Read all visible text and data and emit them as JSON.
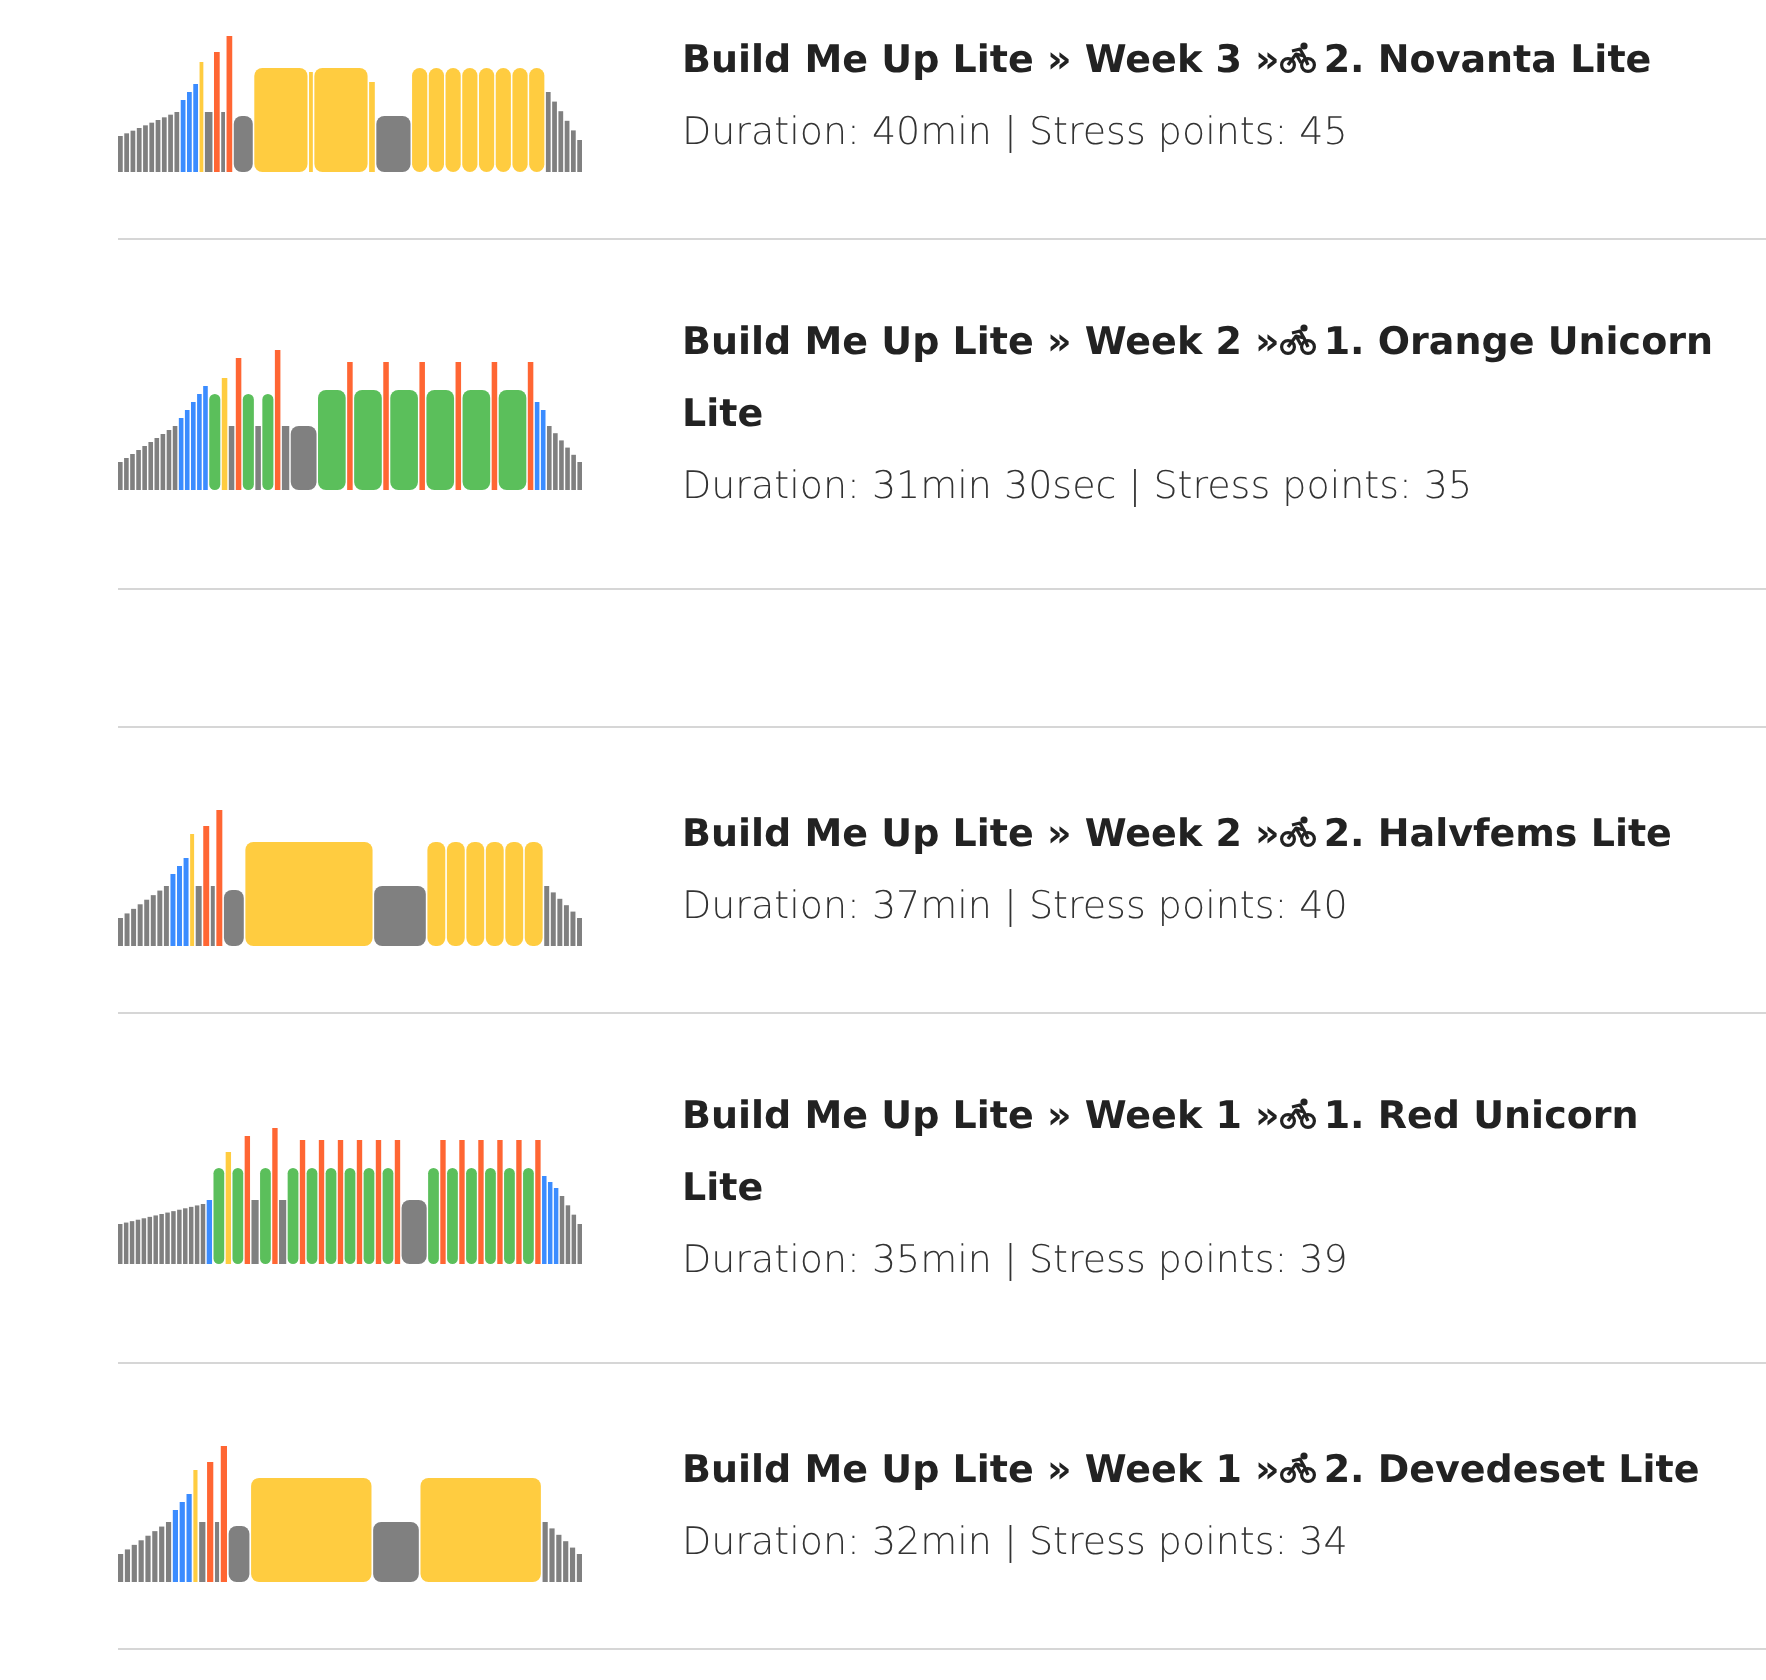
{
  "workouts": [
    {
      "kind": "workout",
      "path": "Build Me Up Lite » Week 3 »",
      "name": "2. Novanta Lite",
      "details": "Duration: 40min | Stress points: 45"
    },
    {
      "kind": "workout",
      "path": "Build Me Up Lite » Week 2 »",
      "name": "1. Orange Unicorn Lite",
      "details": "Duration: 31min 30sec | Stress points: 35"
    },
    {
      "kind": "spacer"
    },
    {
      "kind": "workout",
      "path": "Build Me Up Lite » Week 2 »",
      "name": "2. Halvfems Lite",
      "details": "Duration: 37min | Stress points: 40"
    },
    {
      "kind": "workout",
      "path": "Build Me Up Lite » Week 1 »",
      "name": "1. Red Unicorn Lite",
      "details": "Duration: 35min | Stress points: 39"
    },
    {
      "kind": "workout",
      "path": "Build Me Up Lite » Week 1 »",
      "name": "2. Devedeset Lite",
      "details": "Duration: 32min | Stress points: 34"
    }
  ]
}
